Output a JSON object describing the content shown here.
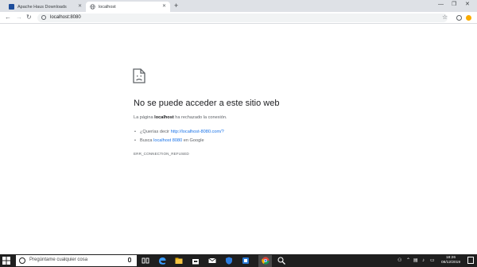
{
  "tabs": [
    {
      "title": "Apache Haus Downloads",
      "active": false,
      "favicon_color": "#1e4d9b"
    },
    {
      "title": "localhost",
      "active": true,
      "favicon_color": "#5f6368"
    }
  ],
  "toolbar": {
    "url": "localhost:8080"
  },
  "error": {
    "title": "No se puede acceder a este sitio web",
    "desc_prefix": "La página",
    "desc_host": "localhost",
    "desc_suffix": "ha rechazado la conexión.",
    "suggestions": [
      {
        "prefix": "¿Querías decir",
        "link": "http://localhost-8080.com/?",
        "suffix": ""
      },
      {
        "prefix": "Busca",
        "link": "localhost 8080",
        "suffix": "en Google"
      }
    ],
    "code": "ERR_CONNECTION_REFUSED"
  },
  "taskbar": {
    "search_placeholder": "Pregúntame cualquier cosa",
    "time": "18:26",
    "date": "08/12/2019",
    "apps": [
      "task-view",
      "edge",
      "file-explorer",
      "store",
      "mail",
      "security",
      "unknown-app",
      "chrome",
      "magnifier"
    ]
  },
  "colors": {
    "accent": "#1a73e8",
    "tabbar": "#dee1e6",
    "taskbar": "#1f1f1f"
  }
}
